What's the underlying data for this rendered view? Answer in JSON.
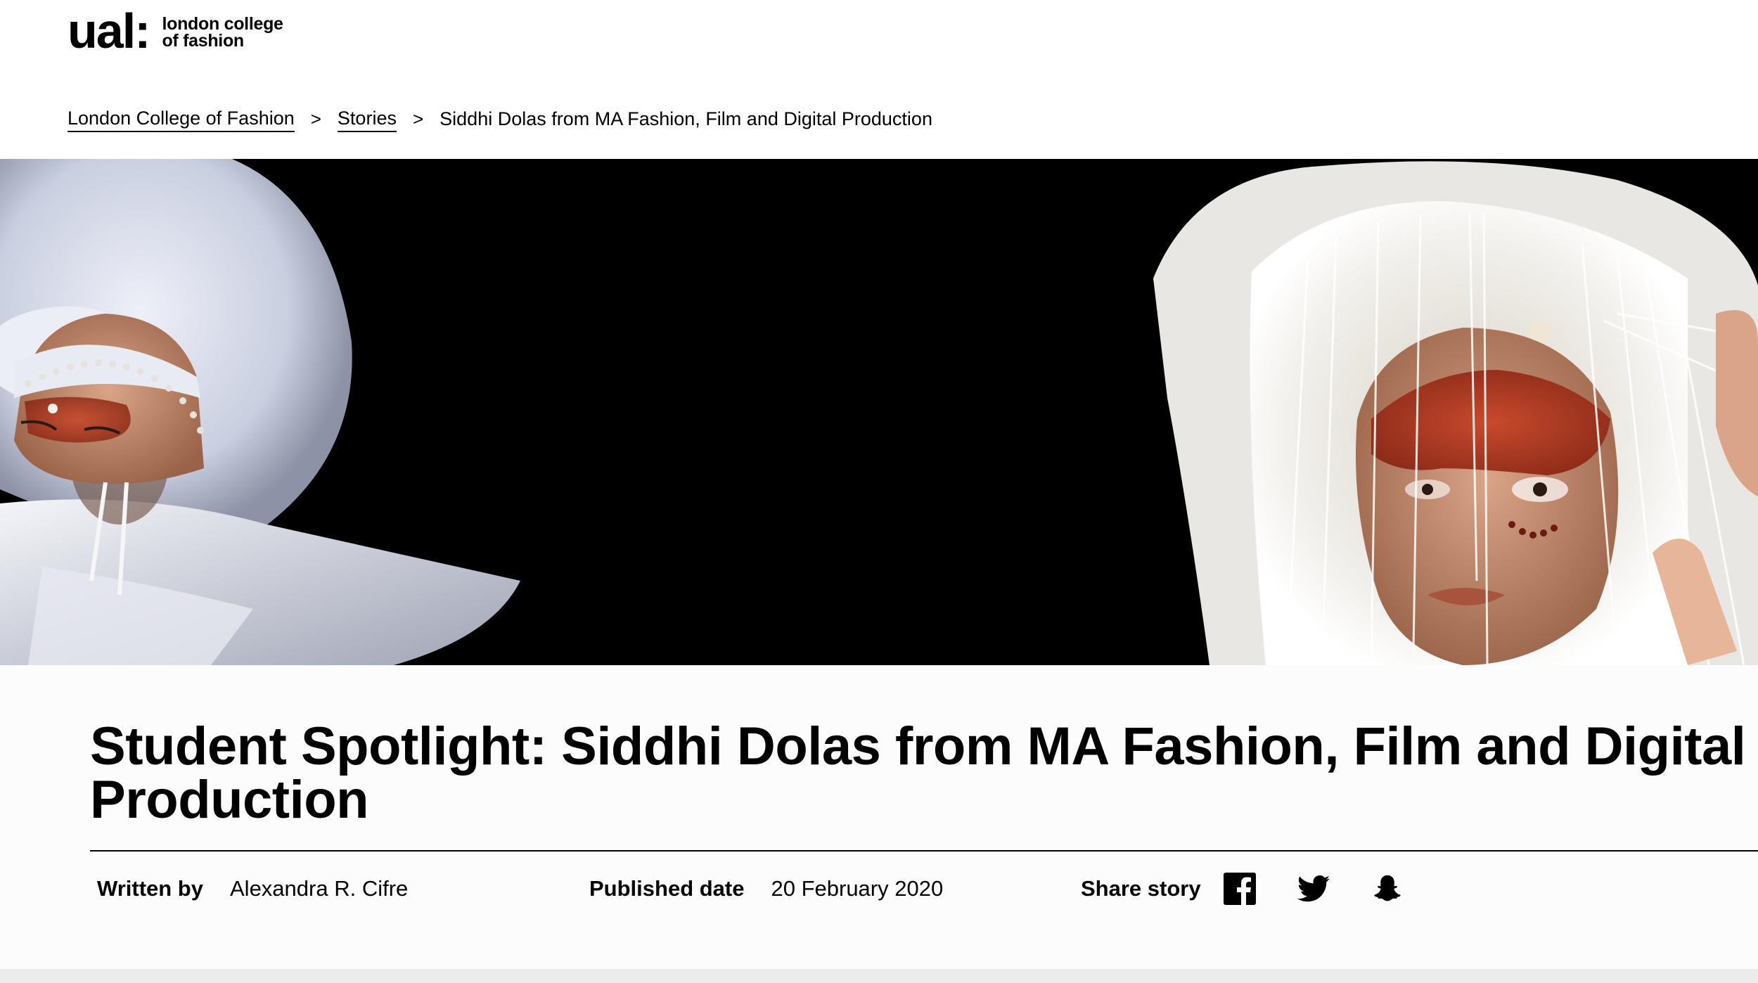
{
  "logo": {
    "mark": "ual:",
    "line1": "london college",
    "line2": "of fashion"
  },
  "breadcrumb": {
    "items": [
      {
        "label": "London College of Fashion"
      },
      {
        "label": "Stories"
      }
    ],
    "separator": ">",
    "current": "Siddhi Dolas from MA Fashion, Film and Digital Production"
  },
  "hero": {
    "alt_left": "model in white wide-brimmed headpiece with red face paint",
    "alt_right": "model in white feathered fringed headdress with red face paint"
  },
  "article": {
    "title": "Student Spotlight: Siddhi Dolas from MA Fashion, Film and Digital Production",
    "written_by_label": "Written by",
    "author": "Alexandra R. Cifre",
    "published_label": "Published date",
    "published_date": "20 February 2020",
    "share_label": "Share story",
    "share_icons": [
      "facebook-icon",
      "twitter-icon",
      "snapchat-icon"
    ]
  },
  "colors": {
    "text": "#000000",
    "hero_bg": "#000000",
    "content_bg": "#fcfcfc"
  }
}
